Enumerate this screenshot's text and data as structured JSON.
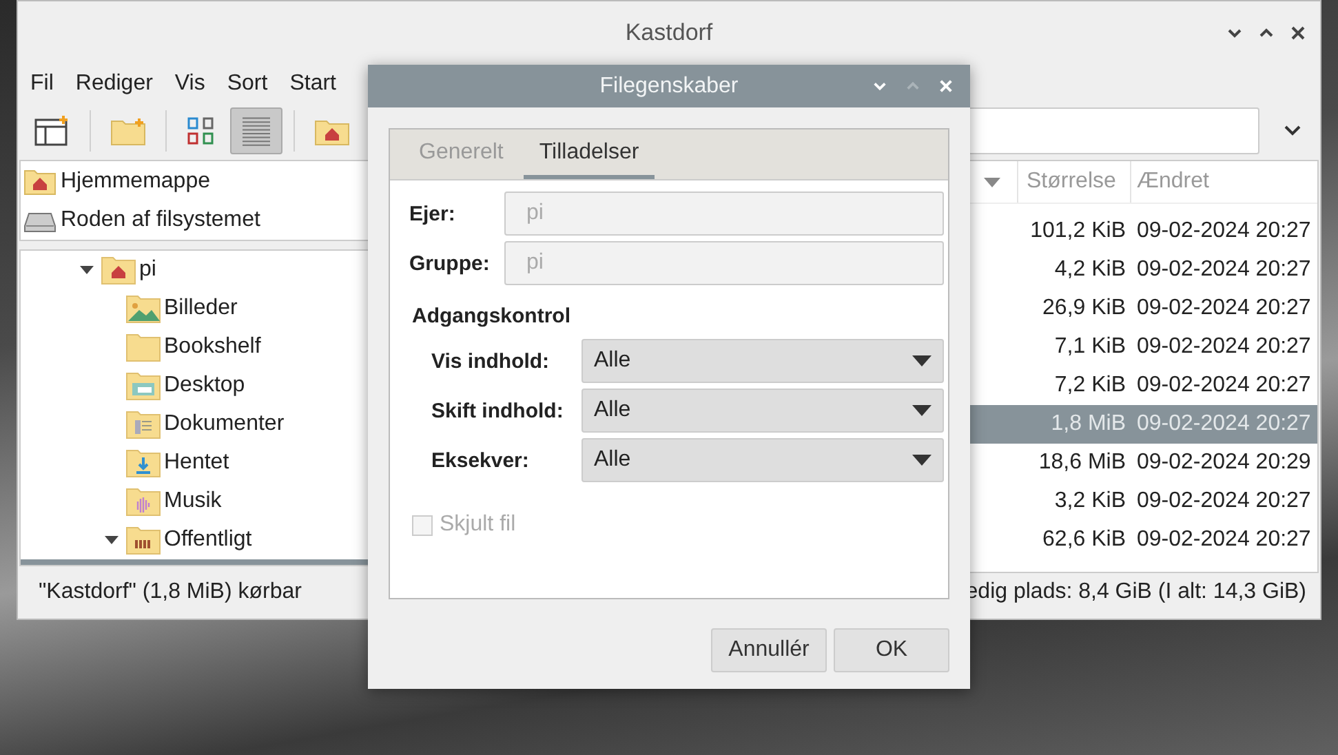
{
  "window": {
    "title": "Kastdorf"
  },
  "menu": [
    "Fil",
    "Rediger",
    "Vis",
    "Sort",
    "Start"
  ],
  "toolbar": {
    "view_modes": [
      {
        "kind": "icons",
        "selected": false
      },
      {
        "kind": "list",
        "selected": true
      }
    ]
  },
  "places": [
    {
      "label": "Hjemmemappe",
      "kind": "home"
    },
    {
      "label": "Roden af filsystemet",
      "kind": "drive"
    }
  ],
  "tree": [
    {
      "label": "pi",
      "kind": "home",
      "expanded": true,
      "selected": false,
      "children": [
        {
          "label": "Billeder",
          "kind": "pictures",
          "selected": false
        },
        {
          "label": "Bookshelf",
          "kind": "plain",
          "selected": false
        },
        {
          "label": "Desktop",
          "kind": "desktop",
          "selected": false
        },
        {
          "label": "Dokumenter",
          "kind": "documents",
          "selected": false
        },
        {
          "label": "Hentet",
          "kind": "downloads",
          "selected": false
        },
        {
          "label": "Musik",
          "kind": "music",
          "selected": false
        },
        {
          "label": "Offentligt",
          "kind": "public",
          "expanded": true,
          "selected": false,
          "children": [
            {
              "selected": true
            }
          ]
        }
      ]
    }
  ],
  "file_list": {
    "columns": [
      {
        "label": "Størrelse"
      },
      {
        "label": "Ændret"
      }
    ],
    "rows": [
      {
        "size": "101,2 KiB",
        "modified": "09-02-2024 20:27",
        "selected": false
      },
      {
        "size": "4,2 KiB",
        "modified": "09-02-2024 20:27",
        "selected": false
      },
      {
        "size": "26,9 KiB",
        "modified": "09-02-2024 20:27",
        "selected": false
      },
      {
        "size": "7,1 KiB",
        "modified": "09-02-2024 20:27",
        "selected": false
      },
      {
        "size": "7,2 KiB",
        "modified": "09-02-2024 20:27",
        "selected": false
      },
      {
        "size": "1,8 MiB",
        "modified": "09-02-2024 20:27",
        "selected": true
      },
      {
        "size": "18,6 MiB",
        "modified": "09-02-2024 20:29",
        "selected": false
      },
      {
        "size": "3,2 KiB",
        "modified": "09-02-2024 20:27",
        "selected": false
      },
      {
        "size": "62,6 KiB",
        "modified": "09-02-2024 20:27",
        "selected": false
      }
    ]
  },
  "status_bar": {
    "selection": "\"Kastdorf\" (1,8 MiB) kørbar",
    "free_space": "edig plads: 8,4 GiB (I alt: 14,3 GiB)"
  },
  "dialog": {
    "title": "Filegenskaber",
    "tabs": [
      {
        "label": "Generelt",
        "selected": false
      },
      {
        "label": "Tilladelser",
        "selected": true
      }
    ],
    "owner": {
      "label": "Ejer:",
      "value": "pi",
      "disabled": true
    },
    "group": {
      "label": "Gruppe:",
      "value": "pi",
      "disabled": true
    },
    "section": "Adgangskontrol",
    "permissions": [
      {
        "label": "Vis indhold:",
        "value": "Alle"
      },
      {
        "label": "Skift indhold:",
        "value": "Alle"
      },
      {
        "label": "Eksekver:",
        "value": "Alle"
      }
    ],
    "hidden_file": {
      "label": "Skjult fil",
      "checked": false,
      "disabled": true
    },
    "buttons": [
      "Annullér",
      "OK"
    ]
  }
}
